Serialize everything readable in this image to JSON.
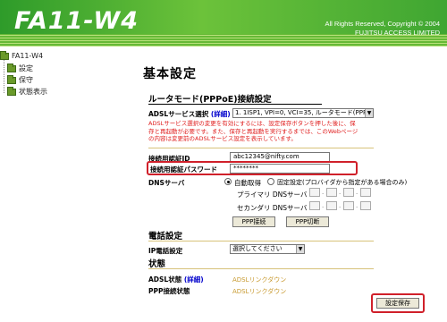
{
  "header": {
    "logo": "FA11-W4",
    "copyright_line1": "All Rights Reserved, Copyright © 2004",
    "copyright_line2": "FUJITSU ACCESS LIMITED"
  },
  "sidebar": {
    "root": "FA11-W4",
    "items": [
      {
        "label": "設定"
      },
      {
        "label": "保守"
      },
      {
        "label": "状態表示"
      }
    ]
  },
  "main": {
    "title": "基本設定",
    "router_section": "ルータモード(PPPoE)接続設定",
    "adsl_select_label": "ADSLサービス選択",
    "detail_link": "(詳細)",
    "adsl_select_value": "1. 1ISP1, VPI=0, VCI=35, ルータモード(PPPoE)接続",
    "warning_text": "ADSLサービス選択の変更を有効にするには、設定保存ボタンを押した後に、保存と再起動が必要です。また、保存と再起動を実行するまでは、このWebページの内容は変更前のADSLサービス設定を表示しています。",
    "auth_id_label": "接続用認証ID",
    "auth_id_value": "abc12345@nifty.com",
    "auth_pw_label": "接続用認証パスワード",
    "auth_pw_value": "********",
    "dns_label": "DNSサーバ",
    "dns_auto": "自動取得",
    "dns_fixed": "固定設定(プロバイダから指定がある場合のみ)",
    "primary_dns": "プライマリ DNSサーバ",
    "secondary_dns": "セカンダリ DNSサーバ",
    "ppp_connect": "PPP接続",
    "ppp_disconnect": "PPP切断",
    "phone_section": "電話設定",
    "ip_phone_label": "IP電話設定",
    "ip_phone_value": "選択してください",
    "status_section": "状態",
    "adsl_status_label": "ADSL状態",
    "adsl_status_detail": "(詳細)",
    "adsl_status_value": "ADSLリンクダウン",
    "ppp_status_label": "PPP接続状態",
    "ppp_status_value": "ADSLリンクダウン",
    "save_button": "設定保存"
  },
  "colors": {
    "header_green": "#3fa632",
    "highlight_red": "#d0202a",
    "warning_red": "#e02020",
    "link_blue": "#0000cc",
    "status_gold": "#c89a30"
  }
}
